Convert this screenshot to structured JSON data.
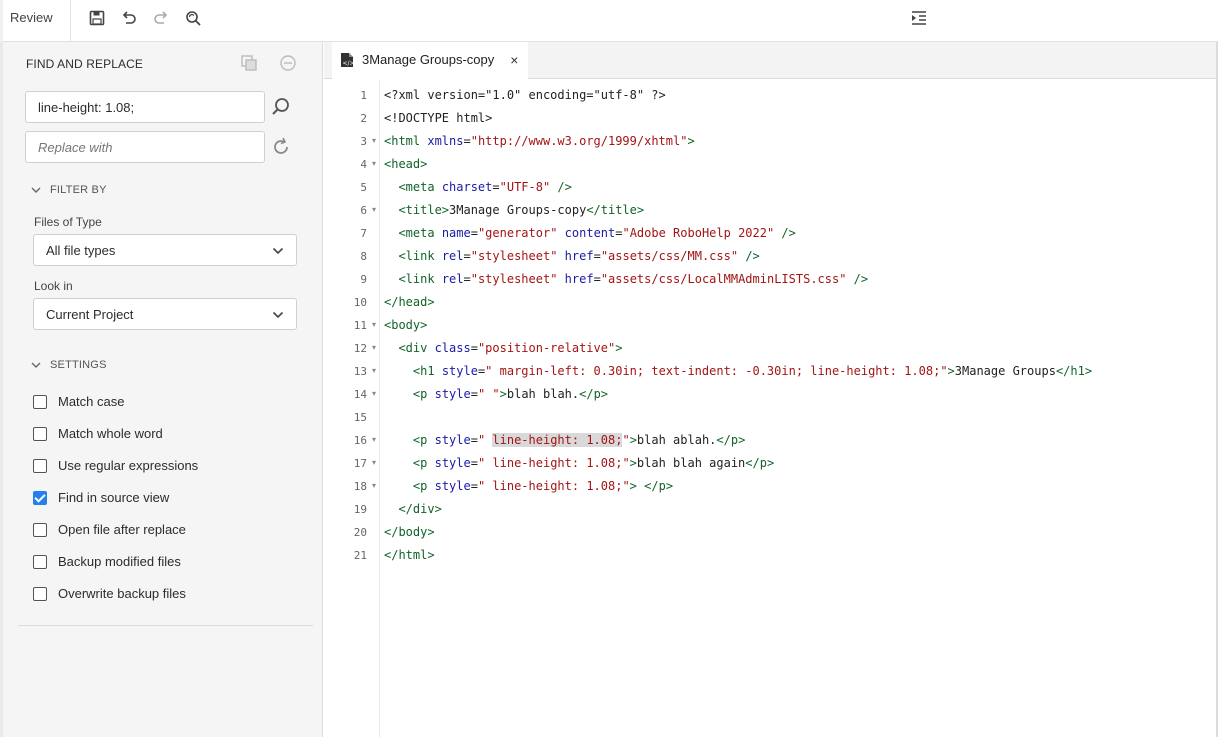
{
  "toolbar": {
    "review_label": "Review",
    "icons": [
      "save-icon",
      "undo-icon",
      "redo-icon",
      "find-replace-icon",
      "collapse-panel-icon"
    ]
  },
  "panel": {
    "title": "FIND AND REPLACE",
    "find_value": "line-height: 1.08;",
    "replace_placeholder": "Replace with",
    "filter_by": "FILTER BY",
    "files_of_type_label": "Files of Type",
    "files_of_type_value": "All file types",
    "look_in_label": "Look in",
    "look_in_value": "Current Project",
    "settings": "SETTINGS",
    "options": [
      {
        "label": "Match case",
        "checked": false
      },
      {
        "label": "Match whole word",
        "checked": false
      },
      {
        "label": "Use regular expressions",
        "checked": false
      },
      {
        "label": "Find in source view",
        "checked": true
      },
      {
        "label": "Open file after replace",
        "checked": false
      },
      {
        "label": "Backup modified files",
        "checked": false
      },
      {
        "label": "Overwrite backup files",
        "checked": false
      }
    ]
  },
  "editor": {
    "tab_title": "3Manage Groups-copy",
    "tab_close": "×",
    "highlight_text": "line-height: 1.08;",
    "lines": [
      {
        "n": "1",
        "fold": false,
        "tokens": [
          [
            "text",
            "<?xml version=\"1.0\" encoding=\"utf-8\" ?>"
          ]
        ]
      },
      {
        "n": "2",
        "fold": false,
        "tokens": [
          [
            "text",
            "<!DOCTYPE html>"
          ]
        ]
      },
      {
        "n": "3",
        "fold": true,
        "tokens": [
          [
            "tag",
            "<html "
          ],
          [
            "attr",
            "xmlns"
          ],
          [
            "text",
            "="
          ],
          [
            "str",
            "\"http://www.w3.org/1999/xhtml\""
          ],
          [
            "tag",
            ">"
          ]
        ]
      },
      {
        "n": "4",
        "fold": true,
        "tokens": [
          [
            "tag",
            "<head>"
          ]
        ]
      },
      {
        "n": "5",
        "fold": false,
        "tokens": [
          [
            "text",
            "  "
          ],
          [
            "tag",
            "<meta "
          ],
          [
            "attr",
            "charset"
          ],
          [
            "text",
            "="
          ],
          [
            "str",
            "\"UTF-8\""
          ],
          [
            "tag",
            " />"
          ]
        ]
      },
      {
        "n": "6",
        "fold": true,
        "tokens": [
          [
            "text",
            "  "
          ],
          [
            "tag",
            "<title>"
          ],
          [
            "text",
            "3Manage Groups-copy"
          ],
          [
            "tag",
            "</title>"
          ]
        ]
      },
      {
        "n": "7",
        "fold": false,
        "tokens": [
          [
            "text",
            "  "
          ],
          [
            "tag",
            "<meta "
          ],
          [
            "attr",
            "name"
          ],
          [
            "text",
            "="
          ],
          [
            "str",
            "\"generator\""
          ],
          [
            "text",
            " "
          ],
          [
            "attr",
            "content"
          ],
          [
            "text",
            "="
          ],
          [
            "str",
            "\"Adobe RoboHelp 2022\""
          ],
          [
            "tag",
            " />"
          ]
        ]
      },
      {
        "n": "8",
        "fold": false,
        "tokens": [
          [
            "text",
            "  "
          ],
          [
            "tag",
            "<link "
          ],
          [
            "attr",
            "rel"
          ],
          [
            "text",
            "="
          ],
          [
            "str",
            "\"stylesheet\""
          ],
          [
            "text",
            " "
          ],
          [
            "attr",
            "href"
          ],
          [
            "text",
            "="
          ],
          [
            "str",
            "\"assets/css/MM.css\""
          ],
          [
            "tag",
            " />"
          ]
        ]
      },
      {
        "n": "9",
        "fold": false,
        "tokens": [
          [
            "text",
            "  "
          ],
          [
            "tag",
            "<link "
          ],
          [
            "attr",
            "rel"
          ],
          [
            "text",
            "="
          ],
          [
            "str",
            "\"stylesheet\""
          ],
          [
            "text",
            " "
          ],
          [
            "attr",
            "href"
          ],
          [
            "text",
            "="
          ],
          [
            "str",
            "\"assets/css/LocalMMAdminLISTS.css\""
          ],
          [
            "tag",
            " />"
          ]
        ]
      },
      {
        "n": "10",
        "fold": false,
        "tokens": [
          [
            "tag",
            "</head>"
          ]
        ]
      },
      {
        "n": "11",
        "fold": true,
        "tokens": [
          [
            "tag",
            "<body>"
          ]
        ]
      },
      {
        "n": "12",
        "fold": true,
        "tokens": [
          [
            "text",
            "  "
          ],
          [
            "tag",
            "<div "
          ],
          [
            "attr",
            "class"
          ],
          [
            "text",
            "="
          ],
          [
            "str",
            "\"position-relative\""
          ],
          [
            "tag",
            ">"
          ]
        ]
      },
      {
        "n": "13",
        "fold": true,
        "tokens": [
          [
            "text",
            "    "
          ],
          [
            "tag",
            "<h1 "
          ],
          [
            "attr",
            "style"
          ],
          [
            "text",
            "="
          ],
          [
            "str",
            "\" margin-left: 0.30in; text-indent: -0.30in; line-height: 1.08;\""
          ],
          [
            "tag",
            ">"
          ],
          [
            "text",
            "3Manage Groups"
          ],
          [
            "tag",
            "</h1>"
          ]
        ]
      },
      {
        "n": "14",
        "fold": true,
        "tokens": [
          [
            "text",
            "    "
          ],
          [
            "tag",
            "<p "
          ],
          [
            "attr",
            "style"
          ],
          [
            "text",
            "="
          ],
          [
            "str",
            "\" \""
          ],
          [
            "tag",
            ">"
          ],
          [
            "text",
            "blah blah."
          ],
          [
            "tag",
            "</p>"
          ]
        ]
      },
      {
        "n": "15",
        "fold": false,
        "tokens": [
          [
            "text",
            ""
          ]
        ]
      },
      {
        "n": "16",
        "fold": true,
        "tokens": [
          [
            "text",
            "    "
          ],
          [
            "tag",
            "<p "
          ],
          [
            "attr",
            "style"
          ],
          [
            "text",
            "="
          ],
          [
            "str",
            "\" "
          ],
          [
            "hl",
            "line-height: 1.08;"
          ],
          [
            "str",
            "\""
          ],
          [
            "tag",
            ">"
          ],
          [
            "text",
            "blah ablah."
          ],
          [
            "tag",
            "</p>"
          ]
        ]
      },
      {
        "n": "17",
        "fold": true,
        "tokens": [
          [
            "text",
            "    "
          ],
          [
            "tag",
            "<p "
          ],
          [
            "attr",
            "style"
          ],
          [
            "text",
            "="
          ],
          [
            "str",
            "\" line-height: 1.08;\""
          ],
          [
            "tag",
            ">"
          ],
          [
            "text",
            "blah blah again"
          ],
          [
            "tag",
            "</p>"
          ]
        ]
      },
      {
        "n": "18",
        "fold": true,
        "tokens": [
          [
            "text",
            "    "
          ],
          [
            "tag",
            "<p "
          ],
          [
            "attr",
            "style"
          ],
          [
            "text",
            "="
          ],
          [
            "str",
            "\" line-height: 1.08;\""
          ],
          [
            "tag",
            ">"
          ],
          [
            "text",
            " "
          ],
          [
            "tag",
            "</p>"
          ]
        ]
      },
      {
        "n": "19",
        "fold": false,
        "tokens": [
          [
            "text",
            "  "
          ],
          [
            "tag",
            "</div>"
          ]
        ]
      },
      {
        "n": "20",
        "fold": false,
        "tokens": [
          [
            "tag",
            "</body>"
          ]
        ]
      },
      {
        "n": "21",
        "fold": false,
        "tokens": [
          [
            "tag",
            "</html>"
          ]
        ]
      }
    ]
  }
}
